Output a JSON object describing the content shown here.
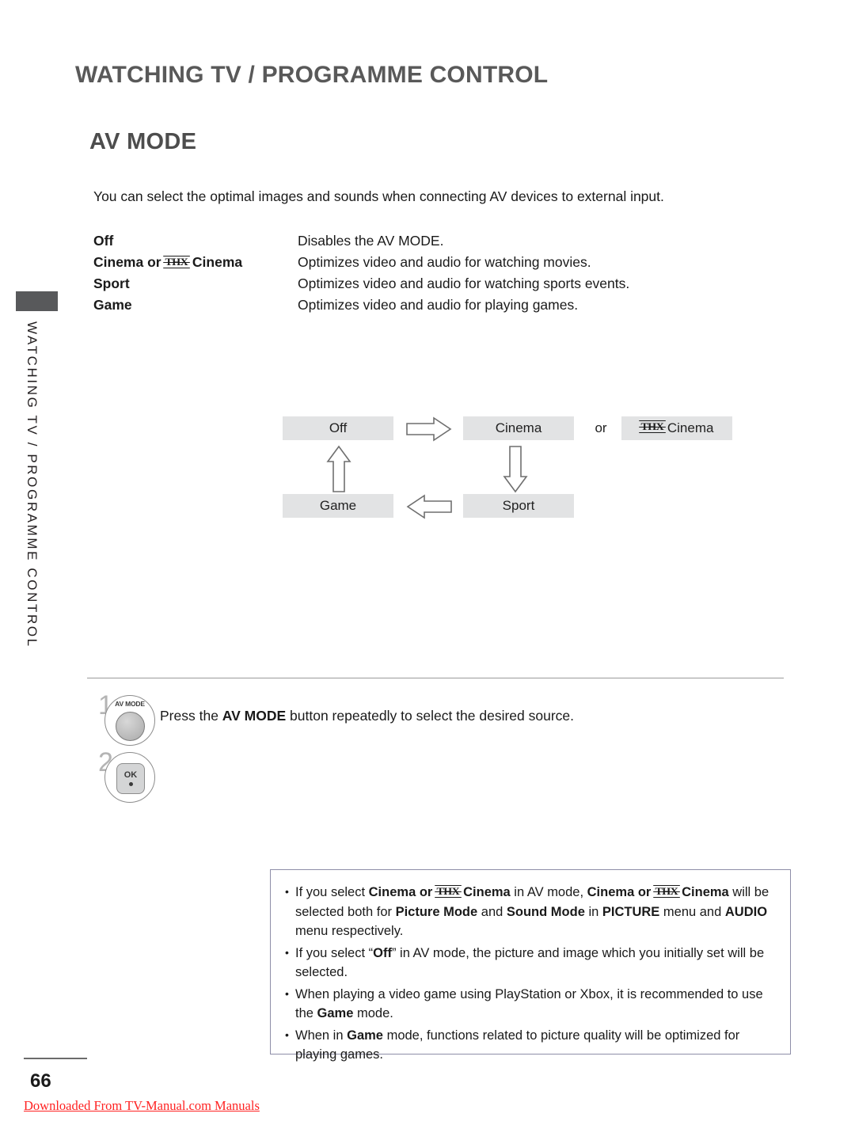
{
  "header": {
    "chapter_title": "WATCHING TV / PROGRAMME CONTROL",
    "section_title": "AV MODE"
  },
  "sidebar": {
    "vertical_label": "WATCHING TV / PROGRAMME CONTROL"
  },
  "intro": {
    "text": "You can select the optimal images and sounds when connecting AV devices to external input."
  },
  "modes": [
    {
      "term": "Off",
      "term_has_thx": false,
      "term_prefix": "Off",
      "term_suffix": "",
      "description": "Disables the AV MODE."
    },
    {
      "term": "Cinema or THX Cinema",
      "term_has_thx": true,
      "term_prefix": "Cinema or ",
      "term_suffix": " Cinema",
      "description": "Optimizes video and audio for watching movies."
    },
    {
      "term": "Sport",
      "term_has_thx": false,
      "term_prefix": "Sport",
      "term_suffix": "",
      "description": "Optimizes video and audio for watching sports events."
    },
    {
      "term": "Game",
      "term_has_thx": false,
      "term_prefix": "Game",
      "term_suffix": "",
      "description": "Optimizes video and audio for playing games."
    }
  ],
  "flow": {
    "boxes": {
      "off": "Off",
      "cinema": "Cinema",
      "thx_cinema_suffix": "Cinema",
      "sport": "Sport",
      "game": "Game"
    },
    "or_label": "or",
    "arrows": [
      "arrow-right",
      "arrow-down",
      "arrow-left",
      "arrow-up"
    ],
    "box_fill": "#e2e3e4"
  },
  "steps": [
    {
      "number": "1",
      "key_label": "AV MODE",
      "key_type": "round",
      "instruction_pre": "Press the ",
      "instruction_bold": "AV MODE",
      "instruction_post": " button repeatedly to select the desired source."
    },
    {
      "number": "2",
      "key_label": "OK",
      "key_type": "rect",
      "instruction_pre": "",
      "instruction_bold": "",
      "instruction_post": ""
    }
  ],
  "notes": [
    "If you select Cinema or THX Cinema in AV mode, Cinema or THX Cinema will be selected both for Picture Mode and Sound Mode in PICTURE menu and AUDIO menu respectively.",
    "If you select “Off” in AV mode, the picture and image which you initially set will be selected.",
    "When playing a video game using PlayStation or Xbox, it is recommended to use the Game mode.",
    "When in Game mode, functions related to picture quality will be optimized for playing games."
  ],
  "footer": {
    "page_number": "66",
    "download_text": "Downloaded From TV-Manual.com Manuals",
    "link_color": "#ff2222"
  },
  "colors": {
    "header_gray": "#595959",
    "sidebar_tab": "#58595b",
    "flow_box": "#e2e3e4",
    "note_border": "#8e8ea8"
  }
}
